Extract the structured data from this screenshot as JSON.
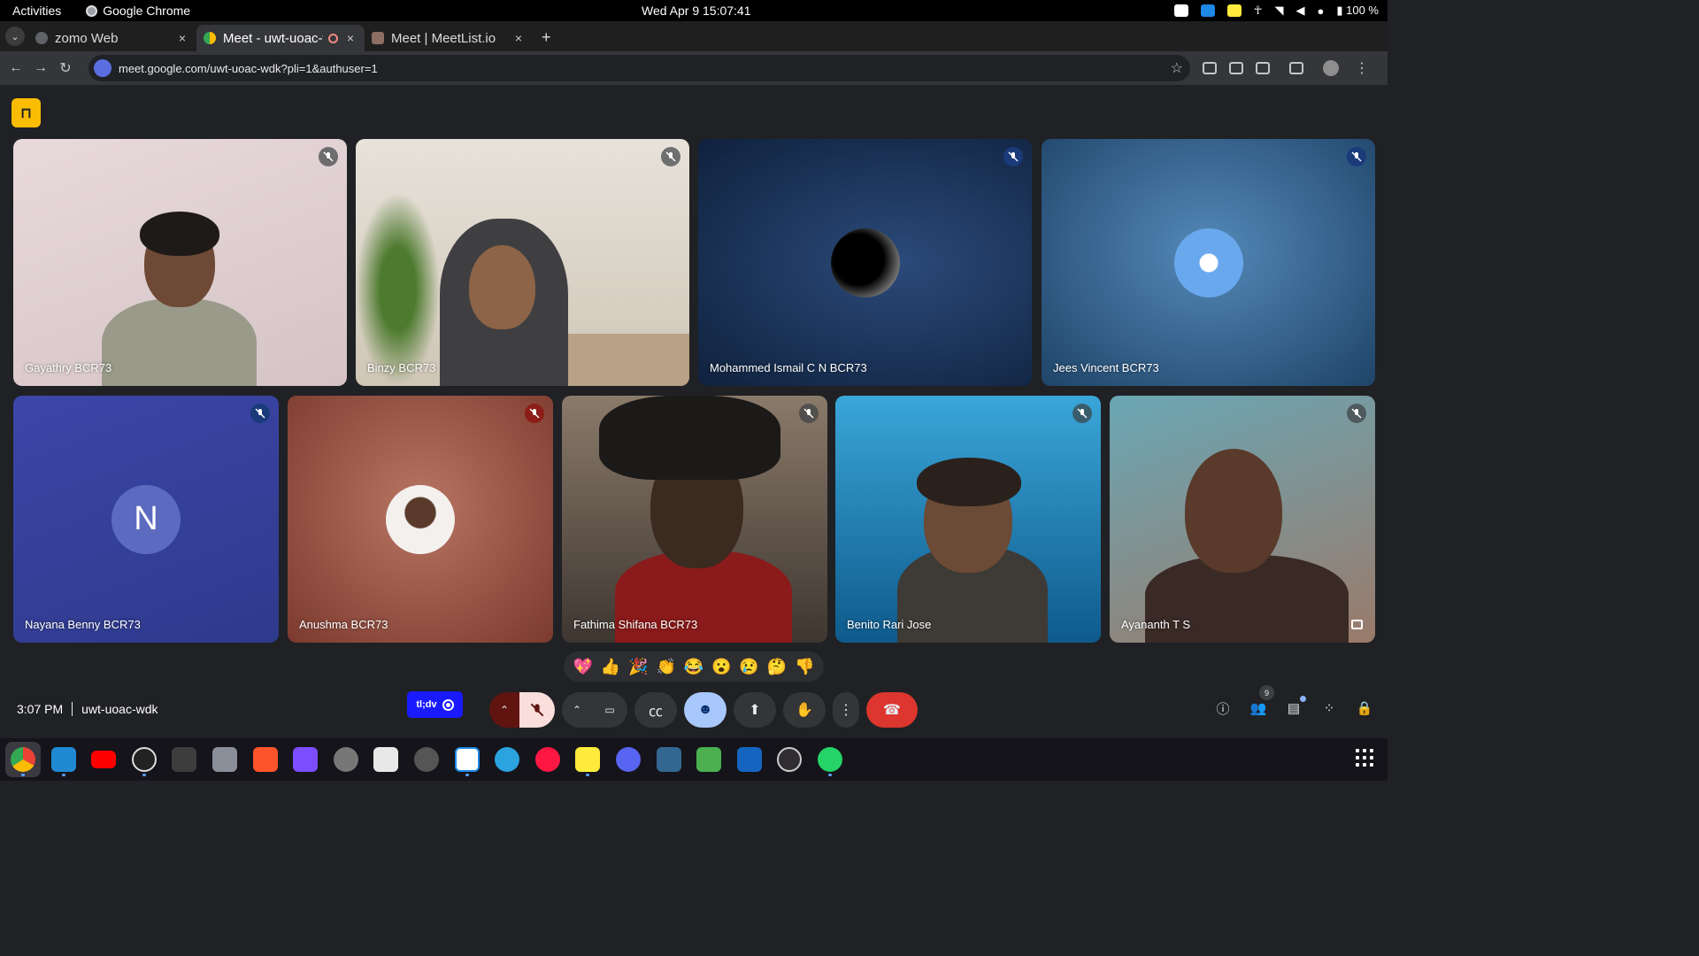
{
  "topbar": {
    "activities": "Activities",
    "app_name": "Google Chrome",
    "clock": "Wed Apr 9  15:07:41",
    "battery": "100 %"
  },
  "tabs": [
    {
      "title": "zomo Web",
      "close": "×"
    },
    {
      "title": "Meet - uwt-uoac-wdk",
      "close": "×"
    },
    {
      "title": "Meet | MeetList.io",
      "close": "×"
    }
  ],
  "new_tab": "+",
  "address_bar": {
    "url": "meet.google.com/uwt-uoac-wdk?pli=1&authuser=1"
  },
  "participants": [
    {
      "name": "Gayathry BCR73"
    },
    {
      "name": "Binzy BCR73"
    },
    {
      "name": "Mohammed Ismail C N BCR73"
    },
    {
      "name": "Jees Vincent BCR73"
    },
    {
      "name": "Nayana Benny BCR73",
      "avatar_letter": "N"
    },
    {
      "name": "Anushma BCR73"
    },
    {
      "name": "Fathima Shifana BCR73"
    },
    {
      "name": "Benito Rari Jose"
    },
    {
      "name": "Ayananth T S"
    }
  ],
  "reactions": [
    "💖",
    "👍",
    "🎉",
    "👏",
    "😂",
    "😮",
    "😢",
    "🤔",
    "👎"
  ],
  "meeting": {
    "time": "3:07 PM",
    "code": "uwt-uoac-wdk"
  },
  "tldv": {
    "label": "tl;dv"
  },
  "people_count": "9",
  "colors": {
    "meet_bg": "#202124",
    "end_call": "#dc362e",
    "active_control": "#a8c7fa",
    "tldv": "#1a1aff"
  }
}
